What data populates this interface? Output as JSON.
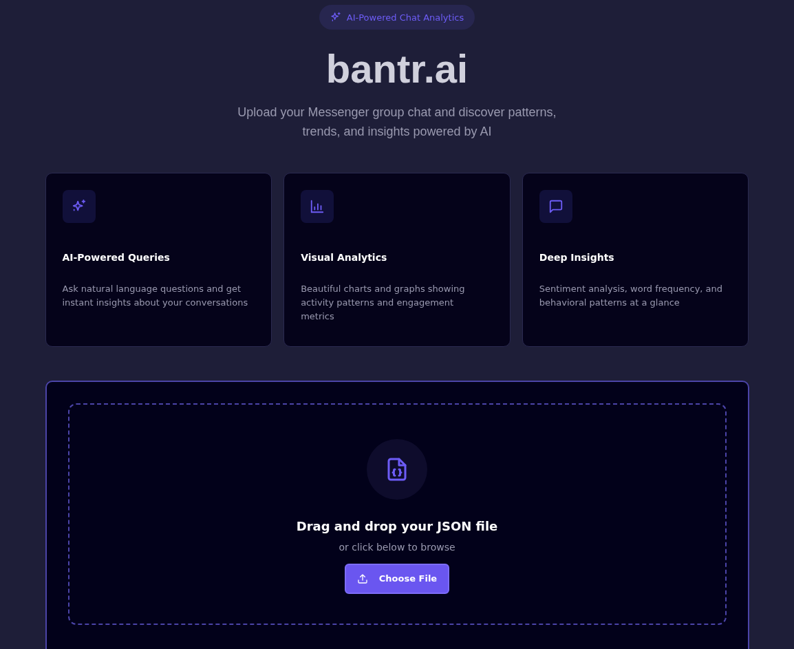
{
  "badge": {
    "label": "AI-Powered Chat Analytics"
  },
  "title": "bantr.ai",
  "subtitle": "Upload your Messenger group chat and discover patterns, trends, and insights powered by AI",
  "features": [
    {
      "kind": "sparkles",
      "title": "AI-Powered Queries",
      "description": "Ask natural language questions and get instant insights about your conversations"
    },
    {
      "kind": "chart",
      "title": "Visual Analytics",
      "description": "Beautiful charts and graphs showing activity patterns and engagement metrics"
    },
    {
      "kind": "chat",
      "title": "Deep Insights",
      "description": "Sentiment analysis, word frequency, and behavioral patterns at a glance"
    }
  ],
  "upload": {
    "heading": "Drag and drop your JSON file",
    "hint": "or click below to browse",
    "button": "Choose File"
  }
}
